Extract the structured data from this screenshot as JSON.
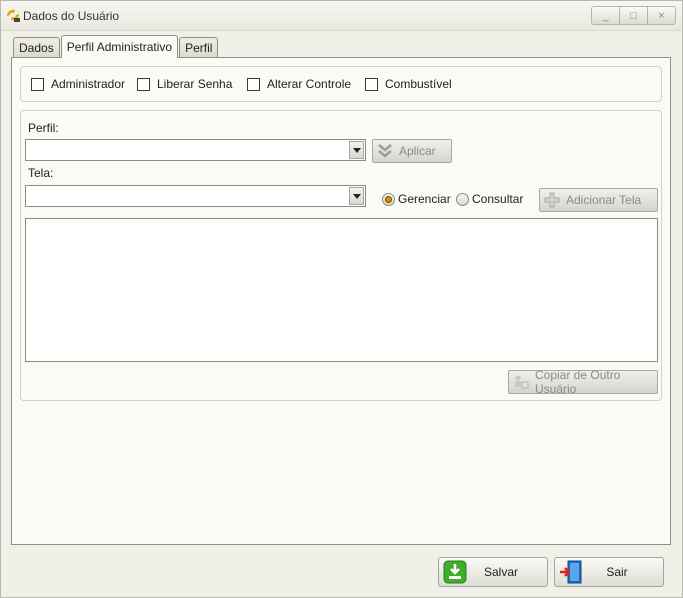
{
  "window": {
    "title": "Dados do Usuário",
    "controls": {
      "minimize": "_",
      "maximize": "□",
      "close": "×"
    }
  },
  "tabs": [
    {
      "label": "Dados"
    },
    {
      "label": "Perfil Administrativo"
    },
    {
      "label": "Perfil"
    }
  ],
  "active_tab": "Perfil Administrativo",
  "permissions": {
    "administrador": {
      "label": "Administrador",
      "checked": false
    },
    "liberar_senha": {
      "label": "Liberar Senha",
      "checked": false
    },
    "alterar_controle": {
      "label": "Alterar Controle",
      "checked": false
    },
    "combustivel": {
      "label": "Combustível",
      "checked": false
    }
  },
  "perfil": {
    "label": "Perfil:",
    "value": ""
  },
  "aplicar_button": "Aplicar",
  "tela": {
    "label": "Tela:",
    "value": ""
  },
  "modes": {
    "gerenciar": {
      "label": "Gerenciar",
      "selected": true
    },
    "consultar": {
      "label": "Consultar",
      "selected": false
    }
  },
  "adicionar_tela_button": "Adicionar Tela",
  "copiar_button": "Copiar de Outro Usuário",
  "footer": {
    "salvar": "Salvar",
    "sair": "Sair"
  },
  "colors": {
    "salvar_icon": "#3fae2a",
    "sair_icon": "#1e6fc0",
    "radio_selected": "#e08a00"
  }
}
